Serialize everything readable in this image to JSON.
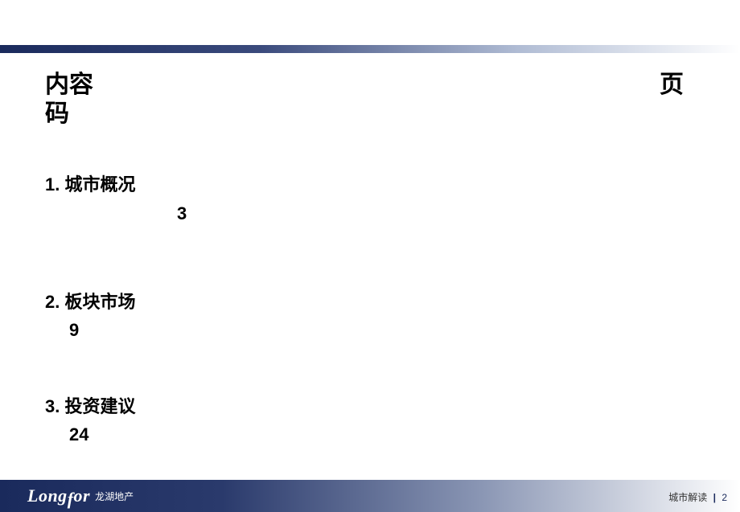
{
  "header": {
    "content_label": "内容",
    "page_label_part1": "页",
    "page_label_part2": "码"
  },
  "toc": [
    {
      "title": "1. 城市概况",
      "page": "3"
    },
    {
      "title": "2. 板块市场",
      "page": "9"
    },
    {
      "title": "3. 投资建议",
      "page": "24"
    }
  ],
  "footer": {
    "logo_text": "Longfor",
    "logo_sub": "龙湖地产",
    "doc_title": "城市解读",
    "page_num": "2"
  }
}
